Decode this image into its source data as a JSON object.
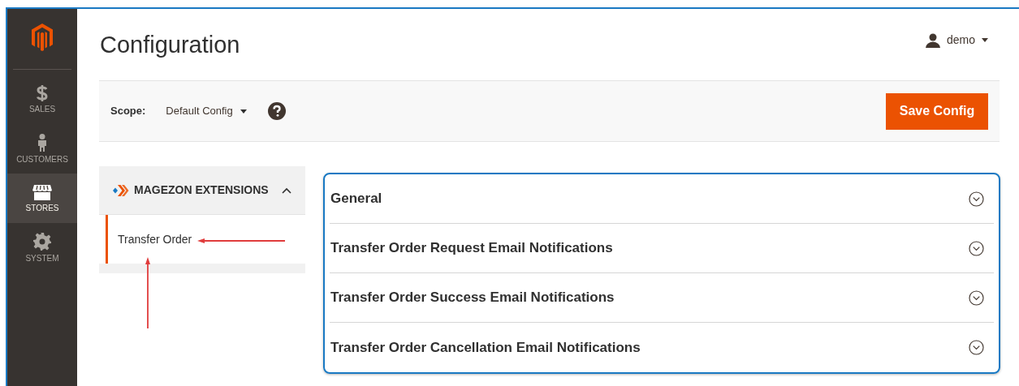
{
  "nav": [
    {
      "label": "SALES",
      "kind": "dollar",
      "selected": false
    },
    {
      "label": "CUSTOMERS",
      "kind": "person",
      "selected": false
    },
    {
      "label": "STORES",
      "kind": "store",
      "selected": true
    },
    {
      "label": "SYSTEM",
      "kind": "gear",
      "selected": false
    }
  ],
  "page_title": "Configuration",
  "user": {
    "name": "demo"
  },
  "scope": {
    "label": "Scope:",
    "value": "Default Config"
  },
  "save_button": "Save Config",
  "tab_group": {
    "title": "MAGEZON EXTENSIONS",
    "expanded": true,
    "items": [
      {
        "label": "Transfer Order",
        "selected": true
      }
    ]
  },
  "sections": [
    {
      "title": "General",
      "expanded": false
    },
    {
      "title": "Transfer Order Request Email Notifications",
      "expanded": false
    },
    {
      "title": "Transfer Order Success Email Notifications",
      "expanded": false
    },
    {
      "title": "Transfer Order Cancellation Email Notifications",
      "expanded": false
    }
  ]
}
